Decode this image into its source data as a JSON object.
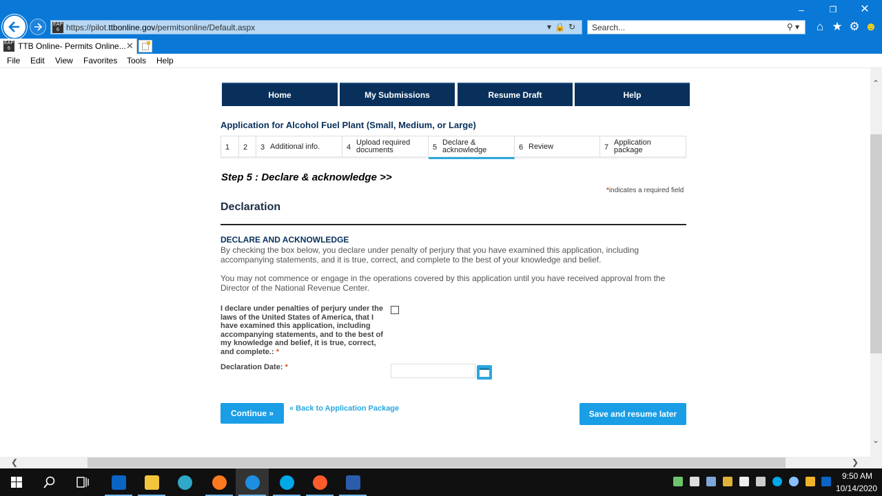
{
  "browser": {
    "url_scheme": "https://pilot.",
    "url_host": "ttbonline.gov",
    "url_path": "/permitsonline/Default.aspx",
    "search_placeholder": "Search...",
    "tab_title": "TTB Online- Permits Online...",
    "menu": [
      "File",
      "Edit",
      "View",
      "Favorites",
      "Tools",
      "Help"
    ]
  },
  "nav": [
    "Home",
    "My Submissions",
    "Resume Draft",
    "Help"
  ],
  "app_title": "Application for Alcohol Fuel Plant (Small, Medium, or Large)",
  "steps": [
    {
      "num": "1",
      "line1": "",
      "line2": ""
    },
    {
      "num": "2",
      "line1": "",
      "line2": ""
    },
    {
      "num": "3",
      "line1": "Additional info.",
      "line2": ""
    },
    {
      "num": "4",
      "line1": "Upload required",
      "line2": "documents"
    },
    {
      "num": "5",
      "line1": "Declare &",
      "line2": "acknowledge"
    },
    {
      "num": "6",
      "line1": "Review",
      "line2": ""
    },
    {
      "num": "7",
      "line1": "Application",
      "line2": "package"
    }
  ],
  "active_step": "5",
  "step_heading": "Step 5 : Declare & acknowledge >>",
  "required_note": "indicates a required field",
  "required_star": "*",
  "section_title": "Declaration",
  "declare_heading": "DECLARE AND ACKNOWLEDGE",
  "paragraph1": "By checking the box below, you declare under penalty of perjury that you have examined this application, including accompanying statements, and it is true, correct, and complete to the best of your knowledge and belief.",
  "paragraph2": "You may not commence or engage in the operations covered by this application until you have received approval from the Director of the National Revenue Center.",
  "declaration_label": "I declare under penalties of perjury under the laws of the United States of America, that I have examined this application, including accompanying statements, and to the best of my knowledge and belief, it is true, correct, and complete.:",
  "declaration_checked": false,
  "date_label": "Declaration Date:",
  "date_value": "",
  "buttons": {
    "continue": "Continue »",
    "back_link": "« Back to Application Package",
    "save": "Save and resume later"
  },
  "taskbar": {
    "time": "9:50 AM",
    "date": "10/14/2020"
  },
  "colors": {
    "chrome_blue": "#0a78d7",
    "nav_navy": "#08305b",
    "accent_blue": "#1a9ee6",
    "required_red": "#d9531e"
  }
}
